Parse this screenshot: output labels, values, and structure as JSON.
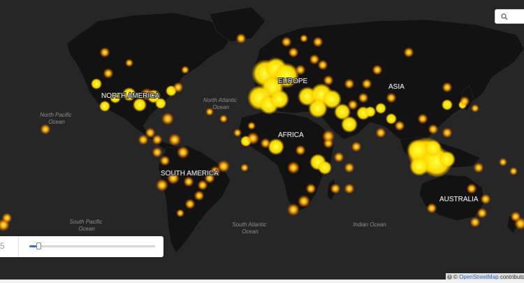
{
  "map": {
    "continent_labels": [
      "NORTH AMERICA",
      "EUROPE",
      "ASIA",
      "AFRICA",
      "SOUTH AMERICA",
      "AUSTRALIA"
    ],
    "ocean_labels": [
      [
        "North Pacific",
        "Ocean"
      ],
      [
        "North Atlantic",
        "Ocean"
      ],
      [
        "South Pacific",
        "Ocean"
      ],
      [
        "South Atlantic",
        "Ocean"
      ],
      [
        "Indian Ocean"
      ]
    ],
    "colors": {
      "background": "#262626",
      "land": "#111111",
      "hotspot_core": "#ffff00",
      "hotspot_mid": "#ffa500",
      "hotspot_edge": "#ff4500"
    }
  },
  "search": {
    "icon": "search-icon"
  },
  "time_slider": {
    "value_label": "5",
    "position": 0.07
  },
  "attribution": {
    "prefix": "©",
    "link_text": "OpenStreetMap",
    "suffix": "contributors",
    "icon": "info-icon"
  }
}
